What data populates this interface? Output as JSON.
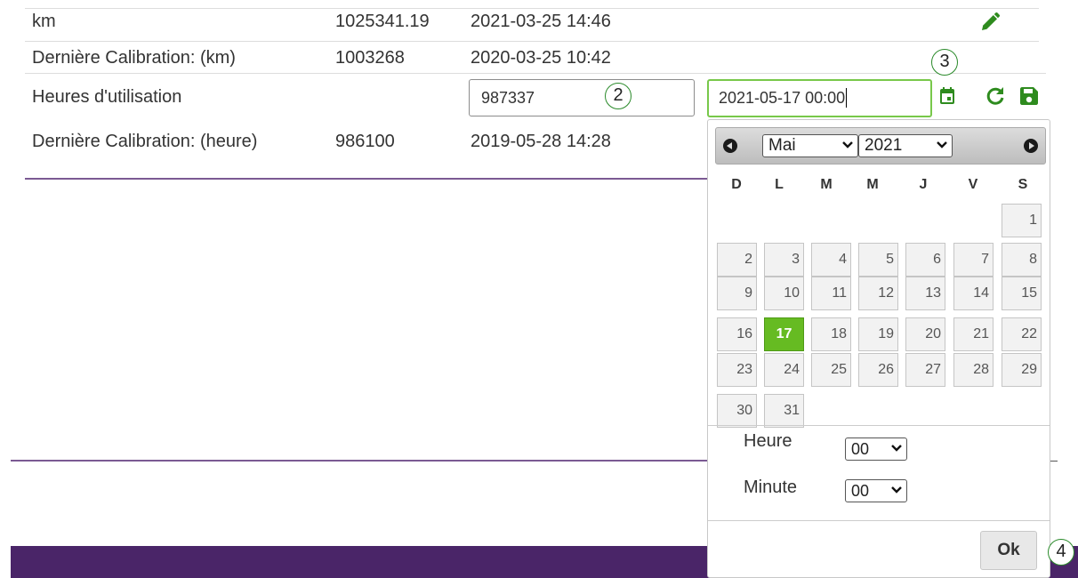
{
  "rows": [
    {
      "label": "km",
      "value": "1025341.19",
      "date": "2021-03-25 14:46"
    },
    {
      "label": "Dernière Calibration: (km)",
      "value": "1003268",
      "date": "2020-03-25 10:42"
    },
    {
      "label": "Heures d'utilisation",
      "value": "",
      "date": ""
    },
    {
      "label": "Dernière Calibration: (heure)",
      "value": "986100",
      "date": "2019-05-28 14:28"
    }
  ],
  "hours_input": {
    "value": "987337"
  },
  "date_input": {
    "value": "2021-05-17 00:00"
  },
  "callouts": [
    "2",
    "3",
    "4"
  ],
  "icons": {
    "edit": "pencil-icon",
    "calendar": "calendar-icon",
    "refresh": "refresh-icon",
    "save": "floppy-disk-icon",
    "accent": "#2e8b1e"
  },
  "datepicker": {
    "month": "Mai",
    "year": "2021",
    "weekdays": [
      "D",
      "L",
      "M",
      "M",
      "J",
      "V",
      "S"
    ],
    "days": [
      "1",
      "2",
      "3",
      "4",
      "5",
      "6",
      "7",
      "8",
      "9",
      "10",
      "11",
      "12",
      "13",
      "14",
      "15",
      "16",
      "17",
      "18",
      "19",
      "20",
      "21",
      "22",
      "23",
      "24",
      "25",
      "26",
      "27",
      "28",
      "29",
      "30",
      "31"
    ],
    "selected_day": "17",
    "hour_label": "Heure",
    "hour_value": "00",
    "minute_label": "Minute",
    "minute_value": "00",
    "ok_label": "Ok",
    "selected_color": "#66bb22"
  },
  "footer_color": "#4a2568"
}
